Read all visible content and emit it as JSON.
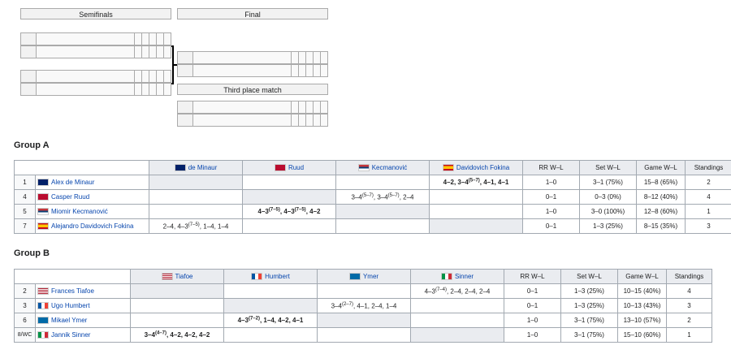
{
  "bracket": {
    "semifinals": "Semifinals",
    "final": "Final",
    "third_place": "Third place match"
  },
  "groupA": {
    "title": "Group A",
    "headers": [
      "de Minaur",
      "Ruud",
      "Kecmanović",
      "Davidovich Fokina",
      "RR W–L",
      "Set W–L",
      "Game W–L",
      "Standings"
    ],
    "rows": [
      {
        "seed": "1",
        "name": "Alex de Minaur",
        "rr": "1–0",
        "set": "3–1 (75%)",
        "game": "15–8 (65%)",
        "standing": "2"
      },
      {
        "seed": "4",
        "name": "Casper Ruud",
        "rr": "0–1",
        "set": "0–3 (0%)",
        "game": "8–12 (40%)",
        "standing": "4"
      },
      {
        "seed": "5",
        "name": "Miomir Kecmanović",
        "rr": "1–0",
        "set": "3–0 (100%)",
        "game": "12–8 (60%)",
        "standing": "1"
      },
      {
        "seed": "7",
        "name": "Alejandro Davidovich Fokina",
        "rr": "0–1",
        "set": "1–3 (25%)",
        "game": "8–15 (35%)",
        "standing": "3"
      }
    ]
  },
  "groupB": {
    "title": "Group B",
    "headers": [
      "Tiafoe",
      "Humbert",
      "Ymer",
      "Sinner",
      "RR W–L",
      "Set W–L",
      "Game W–L",
      "Standings"
    ],
    "rows": [
      {
        "seed": "2",
        "name": "Frances Tiafoe",
        "rr": "0–1",
        "set": "1–3 (25%)",
        "game": "10–15 (40%)",
        "standing": "4"
      },
      {
        "seed": "3",
        "name": "Ugo Humbert",
        "rr": "0–1",
        "set": "1–3 (25%)",
        "game": "10–13 (43%)",
        "standing": "3"
      },
      {
        "seed": "6",
        "name": "Mikael Ymer",
        "rr": "1–0",
        "set": "3–1 (75%)",
        "game": "13–10 (57%)",
        "standing": "2"
      },
      {
        "seed": "8/WC",
        "name": "Jannik Sinner",
        "rr": "1–0",
        "set": "3–1 (75%)",
        "game": "15–10 (60%)",
        "standing": "1"
      }
    ]
  },
  "flag_colors": {
    "aus": "#012169",
    "nor": "#ba0c2f",
    "srb": "#c6363c",
    "esp": "#c60b1e",
    "usa": "#b22234",
    "fra": "#0055a4",
    "swe": "#006aa7",
    "ita": "#009246"
  }
}
